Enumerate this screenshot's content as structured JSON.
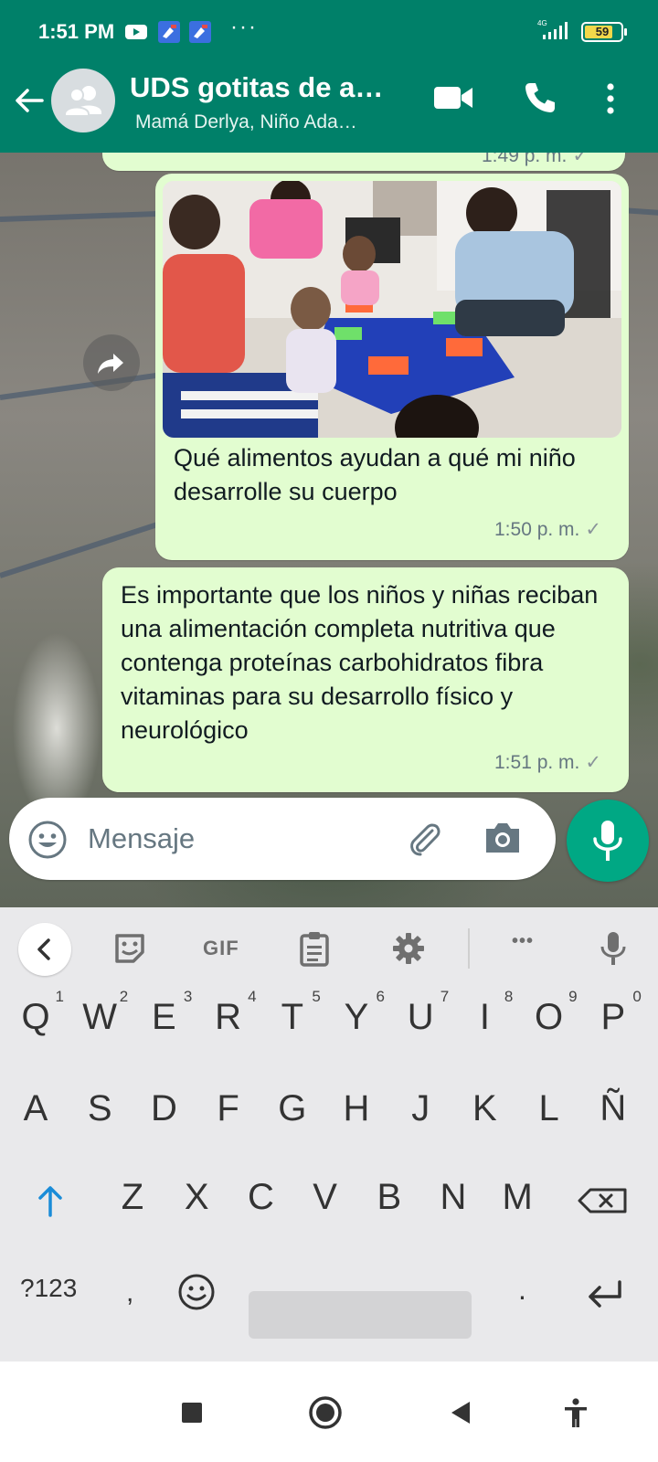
{
  "status_bar": {
    "time": "1:51 PM",
    "dots": "···",
    "network": "4G",
    "battery": "59"
  },
  "header": {
    "title": "UDS gotitas de a…",
    "subtitle": "Mamá Derlya,  Niño Ada…",
    "icons": [
      "back-arrow-icon",
      "group-avatar-icon",
      "video-call-icon",
      "voice-call-icon",
      "more-vert-icon"
    ]
  },
  "messages": [
    {
      "type": "text",
      "time": "1:49 p. m.",
      "partial": true
    },
    {
      "type": "image",
      "caption": "Qué alimentos ayudan a qué mi niño desarrolle su cuerpo",
      "time": "1:50 p. m.",
      "status": "✓"
    },
    {
      "type": "text",
      "text": "Es importante que los niños y niñas reciban una alimentación completa nutritiva que contenga proteínas carbohidratos fibra vitaminas para su desarrollo físico y neurológico",
      "time": "1:51 p. m.",
      "status": "✓"
    }
  ],
  "composer": {
    "placeholder": "Mensaje"
  },
  "keyboard": {
    "toolbar": {
      "gif": "GIF",
      "more": "•••"
    },
    "row1": [
      {
        "k": "Q",
        "n": "1"
      },
      {
        "k": "W",
        "n": "2"
      },
      {
        "k": "E",
        "n": "3"
      },
      {
        "k": "R",
        "n": "4"
      },
      {
        "k": "T",
        "n": "5"
      },
      {
        "k": "Y",
        "n": "6"
      },
      {
        "k": "U",
        "n": "7"
      },
      {
        "k": "I",
        "n": "8"
      },
      {
        "k": "O",
        "n": "9"
      },
      {
        "k": "P",
        "n": "0"
      }
    ],
    "row2": [
      "A",
      "S",
      "D",
      "F",
      "G",
      "H",
      "J",
      "K",
      "L",
      "Ñ"
    ],
    "row3": [
      "Z",
      "X",
      "C",
      "V",
      "B",
      "N",
      "M"
    ],
    "symbols": "?123",
    "comma": ",",
    "period": "."
  },
  "colors": {
    "header": "#008069",
    "bubble_out": "#e2fdd0",
    "accent": "#00a884",
    "shift_active": "#1a8cd8"
  }
}
